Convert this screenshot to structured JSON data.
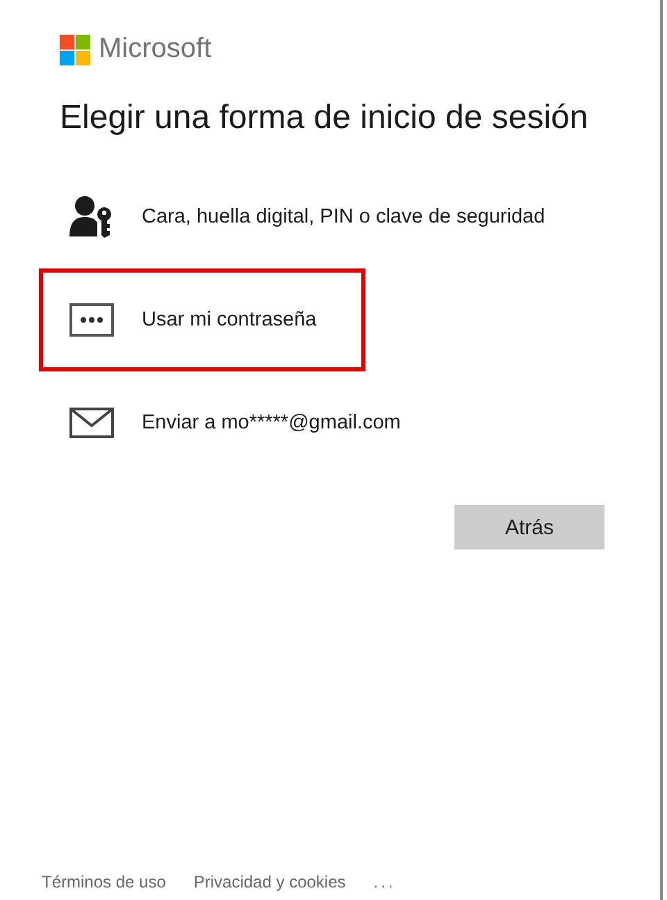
{
  "brand": {
    "name": "Microsoft"
  },
  "heading": "Elegir una forma de inicio de sesión",
  "options": [
    {
      "kind": "person-key",
      "label": "Cara, huella digital, PIN o clave de seguridad",
      "highlighted": false
    },
    {
      "kind": "password",
      "label": "Usar mi contraseña",
      "highlighted": true
    },
    {
      "kind": "mail",
      "label": "Enviar a mo*****@gmail.com",
      "highlighted": false
    }
  ],
  "back_button": "Atrás",
  "footer": {
    "links": [
      "Términos de uso",
      "Privacidad y cookies"
    ],
    "more": "..."
  }
}
